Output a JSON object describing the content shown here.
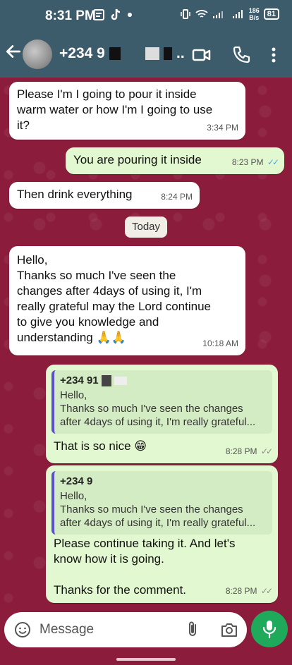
{
  "status_bar": {
    "time": "8:31 PM",
    "net_speed_top": "186",
    "net_speed_bottom": "B/s",
    "battery": "81"
  },
  "header": {
    "contact_name_visible": "+234 9",
    "contact_name_tail": "..",
    "background": "#3d5c6b"
  },
  "chat": {
    "background": "#8b1c3c",
    "messages": [
      {
        "text": "Please I'm I going to pour it inside\nwarm water or how I'm I going to use\nit?",
        "time": "3:34 PM"
      },
      {
        "text": "You are pouring it inside",
        "time": "8:23 PM"
      },
      {
        "text": "Then drink everything",
        "time": "8:24 PM"
      },
      {
        "text": "Hello,\nThanks so much I've seen the\nchanges after 4days of using it, I'm\nreally grateful may the Lord continue\nto give you knowledge and\nunderstanding 🙏🙏",
        "time": "10:18 AM"
      },
      {
        "quote_author": "+234 91",
        "quote_text": "Hello,\nThanks so much I've seen the changes\nafter 4days of using it, I'm really grateful...",
        "text": "That is so nice 😁",
        "time": "8:28 PM"
      },
      {
        "quote_author": "+234 9",
        "quote_text": "Hello,\nThanks so much I've seen the changes\nafter 4days of using it, I'm really grateful...",
        "text": "Please continue taking it. And let's\nknow how it is going.\n\nThanks for the comment.",
        "time": "8:28 PM"
      }
    ],
    "day_divider": "Today"
  },
  "composer": {
    "placeholder": "Message"
  },
  "colors": {
    "accent_green": "#1faa5b",
    "read_ticks": "#4fa7e6",
    "quote_bar": "#5b4fd6"
  }
}
